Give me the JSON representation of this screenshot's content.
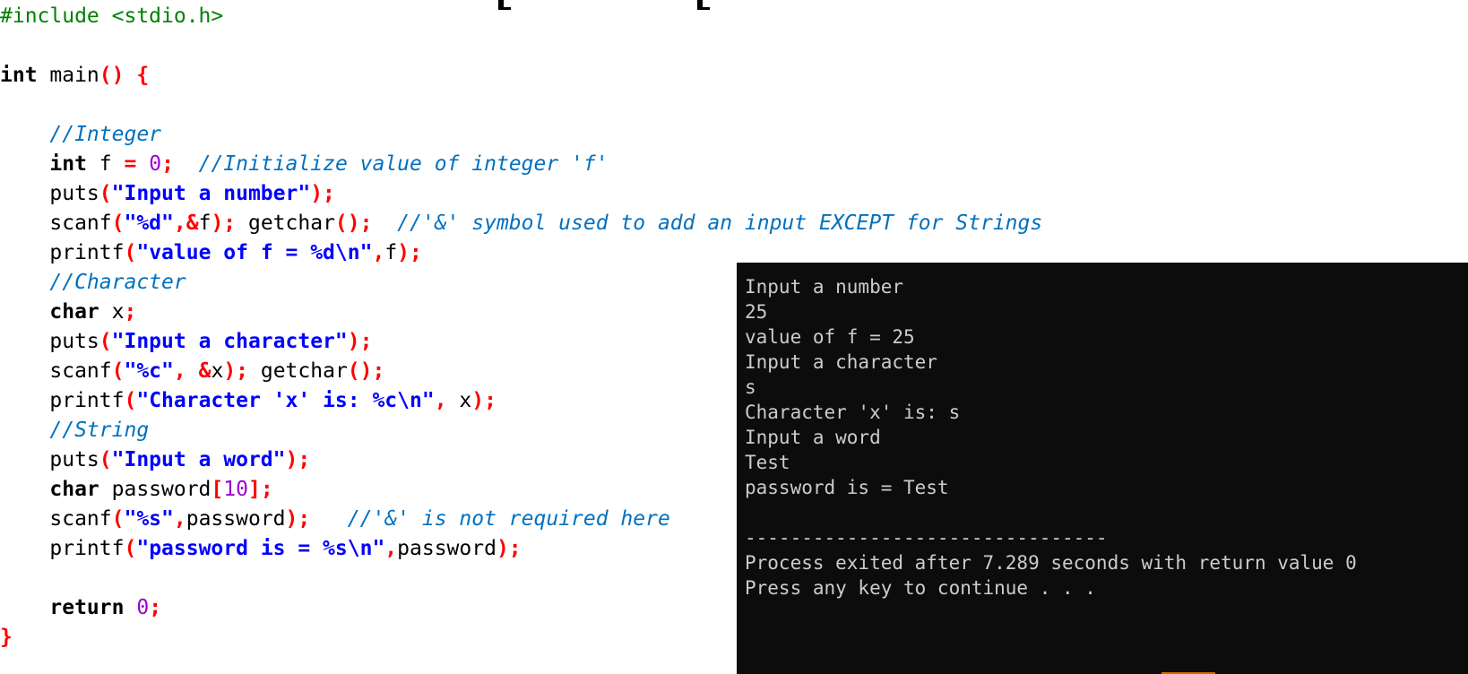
{
  "code": {
    "lines": [
      [
        {
          "t": "#include <stdio.h>",
          "c": "pre"
        }
      ],
      [],
      [
        {
          "t": "int",
          "c": "kw"
        },
        {
          "t": " main",
          "c": "plain"
        },
        {
          "t": "() {",
          "c": "punc"
        }
      ],
      [],
      [
        {
          "t": "    ",
          "c": "plain"
        },
        {
          "t": "//Integer",
          "c": "cmt"
        }
      ],
      [
        {
          "t": "    ",
          "c": "plain"
        },
        {
          "t": "int",
          "c": "kw"
        },
        {
          "t": " f ",
          "c": "plain"
        },
        {
          "t": "=",
          "c": "punc"
        },
        {
          "t": " ",
          "c": "plain"
        },
        {
          "t": "0",
          "c": "num"
        },
        {
          "t": ";",
          "c": "punc"
        },
        {
          "t": "  ",
          "c": "plain"
        },
        {
          "t": "//Initialize value of integer 'f'",
          "c": "cmt"
        }
      ],
      [
        {
          "t": "    puts",
          "c": "plain"
        },
        {
          "t": "(",
          "c": "punc"
        },
        {
          "t": "\"Input a number\"",
          "c": "str"
        },
        {
          "t": ");",
          "c": "punc"
        }
      ],
      [
        {
          "t": "    scanf",
          "c": "plain"
        },
        {
          "t": "(",
          "c": "punc"
        },
        {
          "t": "\"%d\"",
          "c": "str"
        },
        {
          "t": ",&",
          "c": "punc"
        },
        {
          "t": "f",
          "c": "plain"
        },
        {
          "t": ");",
          "c": "punc"
        },
        {
          "t": " getchar",
          "c": "plain"
        },
        {
          "t": "();",
          "c": "punc"
        },
        {
          "t": "  ",
          "c": "plain"
        },
        {
          "t": "//'&' symbol used to add an input EXCEPT for Strings",
          "c": "cmt"
        }
      ],
      [
        {
          "t": "    printf",
          "c": "plain"
        },
        {
          "t": "(",
          "c": "punc"
        },
        {
          "t": "\"value of f = %d\\n\"",
          "c": "str"
        },
        {
          "t": ",",
          "c": "punc"
        },
        {
          "t": "f",
          "c": "plain"
        },
        {
          "t": ");",
          "c": "punc"
        }
      ],
      [
        {
          "t": "    ",
          "c": "plain"
        },
        {
          "t": "//Character",
          "c": "cmt"
        }
      ],
      [
        {
          "t": "    ",
          "c": "plain"
        },
        {
          "t": "char",
          "c": "kw"
        },
        {
          "t": " x",
          "c": "plain"
        },
        {
          "t": ";",
          "c": "punc"
        }
      ],
      [
        {
          "t": "    puts",
          "c": "plain"
        },
        {
          "t": "(",
          "c": "punc"
        },
        {
          "t": "\"Input a character\"",
          "c": "str"
        },
        {
          "t": ");",
          "c": "punc"
        }
      ],
      [
        {
          "t": "    scanf",
          "c": "plain"
        },
        {
          "t": "(",
          "c": "punc"
        },
        {
          "t": "\"%c\"",
          "c": "str"
        },
        {
          "t": ",",
          "c": "punc"
        },
        {
          "t": " ",
          "c": "plain"
        },
        {
          "t": "&",
          "c": "punc"
        },
        {
          "t": "x",
          "c": "plain"
        },
        {
          "t": ");",
          "c": "punc"
        },
        {
          "t": " getchar",
          "c": "plain"
        },
        {
          "t": "();",
          "c": "punc"
        }
      ],
      [
        {
          "t": "    printf",
          "c": "plain"
        },
        {
          "t": "(",
          "c": "punc"
        },
        {
          "t": "\"Character 'x' is: %c\\n\"",
          "c": "str"
        },
        {
          "t": ",",
          "c": "punc"
        },
        {
          "t": " x",
          "c": "plain"
        },
        {
          "t": ");",
          "c": "punc"
        }
      ],
      [
        {
          "t": "    ",
          "c": "plain"
        },
        {
          "t": "//String",
          "c": "cmt"
        }
      ],
      [
        {
          "t": "    puts",
          "c": "plain"
        },
        {
          "t": "(",
          "c": "punc"
        },
        {
          "t": "\"Input a word\"",
          "c": "str"
        },
        {
          "t": ");",
          "c": "punc"
        }
      ],
      [
        {
          "t": "    ",
          "c": "plain"
        },
        {
          "t": "char",
          "c": "kw"
        },
        {
          "t": " password",
          "c": "plain"
        },
        {
          "t": "[",
          "c": "punc"
        },
        {
          "t": "10",
          "c": "num"
        },
        {
          "t": "];",
          "c": "punc"
        }
      ],
      [
        {
          "t": "    scanf",
          "c": "plain"
        },
        {
          "t": "(",
          "c": "punc"
        },
        {
          "t": "\"%s\"",
          "c": "str"
        },
        {
          "t": ",",
          "c": "punc"
        },
        {
          "t": "password",
          "c": "plain"
        },
        {
          "t": ");",
          "c": "punc"
        },
        {
          "t": "   ",
          "c": "plain"
        },
        {
          "t": "//'&' is not required here",
          "c": "cmt"
        }
      ],
      [
        {
          "t": "    printf",
          "c": "plain"
        },
        {
          "t": "(",
          "c": "punc"
        },
        {
          "t": "\"password is = %s\\n\"",
          "c": "str"
        },
        {
          "t": ",",
          "c": "punc"
        },
        {
          "t": "password",
          "c": "plain"
        },
        {
          "t": ");",
          "c": "punc"
        }
      ],
      [],
      [
        {
          "t": "    ",
          "c": "plain"
        },
        {
          "t": "return",
          "c": "kw"
        },
        {
          "t": " ",
          "c": "plain"
        },
        {
          "t": "0",
          "c": "num"
        },
        {
          "t": ";",
          "c": "punc"
        }
      ],
      [
        {
          "t": "}",
          "c": "punc"
        }
      ]
    ]
  },
  "console": {
    "lines": [
      "Input a number",
      "25",
      "value of f = 25",
      "Input a character",
      "s",
      "Character 'x' is: s",
      "Input a word",
      "Test",
      "password is = Test",
      "",
      "--------------------------------",
      "Process exited after 7.289 seconds with return value 0",
      "Press any key to continue . . ."
    ]
  },
  "colors": {
    "preprocessor": "#008000",
    "keyword": "#000000",
    "punctuation": "#ff0000",
    "string": "#0000ff",
    "number": "#9b00d6",
    "comment": "#0070c0",
    "console_background": "#0c0c0c",
    "console_text": "#cccccc"
  }
}
